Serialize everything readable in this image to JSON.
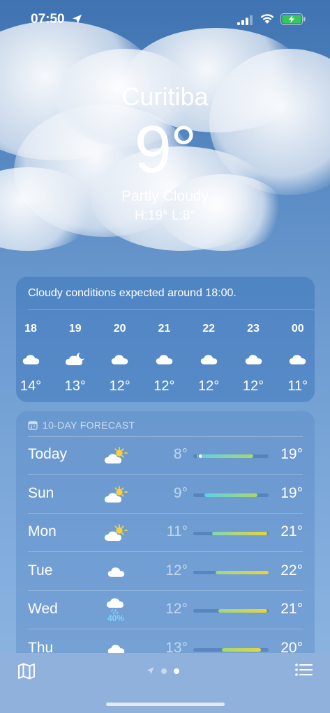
{
  "status_bar": {
    "time": "07:50"
  },
  "header": {
    "city": "Curitiba",
    "temperature": "9°",
    "condition": "Partly Cloudy",
    "high_low": "H:19°  L:8°"
  },
  "hourly": {
    "message": "Cloudy conditions expected around 18:00.",
    "hours": [
      {
        "hour": "18",
        "icon": "cloud-icon",
        "temp": "14°"
      },
      {
        "hour": "19",
        "icon": "cloud-moon-icon",
        "temp": "13°"
      },
      {
        "hour": "20",
        "icon": "cloud-icon",
        "temp": "12°"
      },
      {
        "hour": "21",
        "icon": "cloud-icon",
        "temp": "12°"
      },
      {
        "hour": "22",
        "icon": "cloud-icon",
        "temp": "12°"
      },
      {
        "hour": "23",
        "icon": "cloud-icon",
        "temp": "12°"
      },
      {
        "hour": "00",
        "icon": "cloud-icon",
        "temp": "11°"
      }
    ]
  },
  "forecast": {
    "title": "10-DAY FORECAST",
    "days": [
      {
        "day": "Today",
        "icon": "partly-sunny-icon",
        "low": "8°",
        "high": "19°",
        "precip": "",
        "bar_start": 0.05,
        "bar_end": 0.8,
        "current": 0.1,
        "colors": [
          "#5fd0e6",
          "#a8d86a"
        ]
      },
      {
        "day": "Sun",
        "icon": "partly-sunny-icon",
        "low": "9°",
        "high": "19°",
        "precip": "",
        "bar_start": 0.15,
        "bar_end": 0.85,
        "current": null,
        "colors": [
          "#5fd0e6",
          "#a8d86a"
        ]
      },
      {
        "day": "Mon",
        "icon": "partly-sunny-icon",
        "low": "11°",
        "high": "21°",
        "precip": "",
        "bar_start": 0.25,
        "bar_end": 0.98,
        "current": null,
        "colors": [
          "#80d6b8",
          "#e8d532"
        ]
      },
      {
        "day": "Tue",
        "icon": "cloud-icon",
        "low": "12°",
        "high": "22°",
        "precip": "",
        "bar_start": 0.3,
        "bar_end": 1.0,
        "current": null,
        "colors": [
          "#9bd68c",
          "#f0d22a"
        ]
      },
      {
        "day": "Wed",
        "icon": "cloud-rain-icon",
        "low": "12°",
        "high": "21°",
        "precip": "40%",
        "bar_start": 0.33,
        "bar_end": 0.98,
        "current": null,
        "colors": [
          "#9bd68c",
          "#e8d532"
        ]
      },
      {
        "day": "Thu",
        "icon": "cloud-icon",
        "low": "13°",
        "high": "20°",
        "precip": "",
        "bar_start": 0.38,
        "bar_end": 0.9,
        "current": null,
        "colors": [
          "#a8d86a",
          "#e0d83a"
        ]
      }
    ]
  },
  "bottom_bar": {
    "map_icon": "map-icon",
    "list_icon": "list-icon"
  }
}
